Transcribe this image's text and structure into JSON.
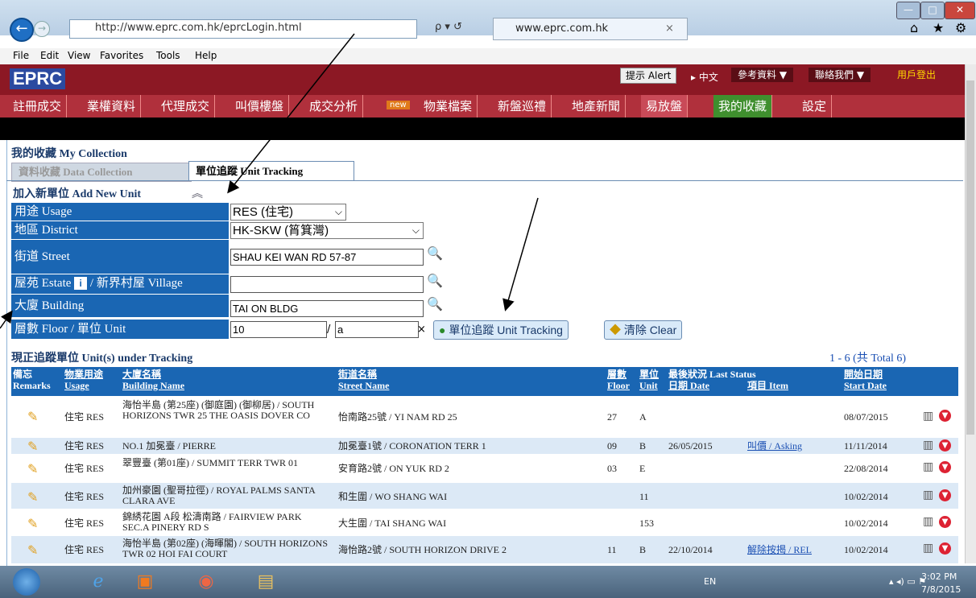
{
  "browser": {
    "url": "http://www.eprc.com.hk/eprcLogin.html",
    "search_label": "ρ ▾ ↺",
    "tab_title": "www.eprc.com.hk",
    "tab_close": "×",
    "menu": [
      "File",
      "Edit",
      "View",
      "Favorites",
      "Tools",
      "Help"
    ]
  },
  "header": {
    "logo": "EPRC",
    "alert": "提示 Alert",
    "lang": "▸ 中文",
    "links": [
      "參考資料 ▼",
      "聯絡我們 ▼"
    ],
    "logout": "用戶登出"
  },
  "nav": {
    "items": [
      "註冊成交",
      "業權資料",
      "代理成交",
      "叫價樓盤",
      "成交分析",
      "物業檔案",
      "新盤巡禮",
      "地產新聞",
      "易放盤",
      "我的收藏",
      "設定"
    ],
    "new_badge": "new"
  },
  "collection": {
    "title": "我的收藏 My Collection",
    "tab_data": "資料收藏 Data Collection",
    "tab_unit": "單位追蹤 Unit Tracking"
  },
  "form": {
    "title": "加入新單位 Add New Unit",
    "usage_label": "用途 Usage",
    "usage_value": "RES (住宅)",
    "district_label": "地區 District",
    "district_value": "HK-SKW (筲箕灣)",
    "street_label": "街道 Street",
    "street_value": "SHAU KEI WAN RD 57-87",
    "estate_label_a": "屋苑 Estate",
    "estate_info": "i",
    "estate_label_b": "/ 新界村屋 Village",
    "estate_value": "",
    "building_label": "大廈 Building",
    "building_value": "TAI ON BLDG",
    "floor_label": "層數 Floor / 單位 Unit",
    "floor_value": "10",
    "slash": "/",
    "unit_value": "a",
    "clear_x": "×",
    "track_button": "單位追蹤 Unit Tracking",
    "clear_button": "清除 Clear"
  },
  "tracking": {
    "title": "現正追蹤單位 Unit(s) under Tracking",
    "count": "1 - 6 (共 Total 6)",
    "headers": {
      "remarks": [
        "備忘",
        "Remarks"
      ],
      "usage": [
        "物業用途",
        "Usage"
      ],
      "building": [
        "大廈名稱",
        "Building Name"
      ],
      "street": [
        "街道名稱",
        "Street Name"
      ],
      "floor": [
        "層數",
        "Floor"
      ],
      "unit": [
        "單位",
        "Unit"
      ],
      "last_status": "最後狀況 Last Status",
      "date": "日期 Date",
      "item": "項目 Item",
      "start": [
        "開始日期",
        "Start Date"
      ]
    },
    "rows": [
      {
        "usage": "住宅 RES",
        "building": "海怡半島 (第25座) (御庭園) (御柳居) / SOUTH HORIZONS TWR 25 THE OASIS DOVER CO",
        "street": "怡南路25號 / YI NAM RD 25",
        "floor": "27",
        "unit": "A",
        "date": "",
        "item": "",
        "start": "08/07/2015"
      },
      {
        "usage": "住宅 RES",
        "building": "NO.1 加冕臺 / PIERRE",
        "street": "加冕臺1號 / CORONATION TERR 1",
        "floor": "09",
        "unit": "B",
        "date": "26/05/2015",
        "item": "叫價 / Asking",
        "start": "11/11/2014"
      },
      {
        "usage": "住宅 RES",
        "building": "翠豐臺 (第01座) / SUMMIT TERR TWR 01",
        "street": "安育路2號 / ON YUK RD 2",
        "floor": "03",
        "unit": "E",
        "date": "",
        "item": "",
        "start": "22/08/2014"
      },
      {
        "usage": "住宅 RES",
        "building": "加州豪園 (聖哥拉徑) / ROYAL PALMS SANTA CLARA AVE",
        "street": "和生圍 / WO SHANG WAI",
        "floor": "",
        "unit": "11",
        "date": "",
        "item": "",
        "start": "10/02/2014"
      },
      {
        "usage": "住宅 RES",
        "building": "錦綉花園 A段 松濤南路 / FAIRVIEW PARK SEC.A PINERY RD S",
        "street": "大生圍 / TAI SHANG WAI",
        "floor": "",
        "unit": "153",
        "date": "",
        "item": "",
        "start": "10/02/2014"
      },
      {
        "usage": "住宅 RES",
        "building": "海怡半島 (第02座) (海暉閣) / SOUTH HORIZONS TWR 02 HOI FAI COURT",
        "street": "海怡路2號 / SOUTH HORIZON DRIVE 2",
        "floor": "11",
        "unit": "B",
        "date": "22/10/2014",
        "item": "解除按揭 / REL",
        "start": "10/02/2014"
      }
    ]
  },
  "taskbar": {
    "lang": "EN",
    "time": "3:02 PM",
    "date": "7/8/2015"
  }
}
